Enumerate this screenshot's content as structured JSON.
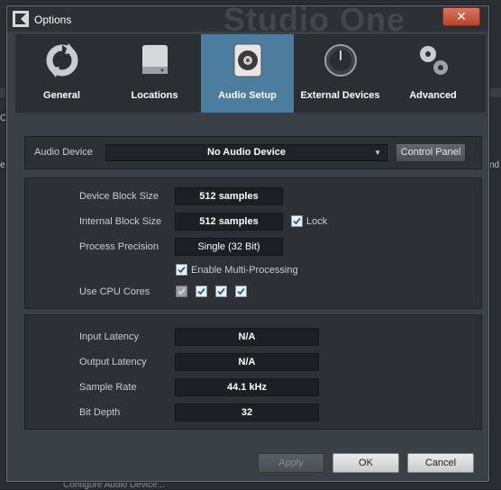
{
  "window": {
    "title": "Options",
    "watermark": "Studio One"
  },
  "tabs": [
    {
      "label": "General",
      "icon": "refresh-icon"
    },
    {
      "label": "Locations",
      "icon": "hard-drive-icon"
    },
    {
      "label": "Audio Setup",
      "icon": "speaker-icon",
      "active": true
    },
    {
      "label": "External Devices",
      "icon": "knob-icon"
    },
    {
      "label": "Advanced",
      "icon": "gears-icon"
    }
  ],
  "audio_device": {
    "label": "Audio Device",
    "value": "No Audio Device",
    "control_panel": "Control Panel"
  },
  "settings": {
    "device_block_size": {
      "label": "Device Block Size",
      "value": "512 samples"
    },
    "internal_block_size": {
      "label": "Internal Block Size",
      "value": "512 samples",
      "lock_label": "Lock",
      "lock_checked": true
    },
    "process_precision": {
      "label": "Process Precision",
      "value": "Single (32 Bit)"
    },
    "multi_processing": {
      "label": "Enable Multi-Processing",
      "checked": true
    },
    "cpu_cores": {
      "label": "Use CPU Cores",
      "cores": [
        {
          "checked": true,
          "enabled": false
        },
        {
          "checked": true,
          "enabled": true
        },
        {
          "checked": true,
          "enabled": true
        },
        {
          "checked": true,
          "enabled": true
        }
      ]
    }
  },
  "info": {
    "input_latency": {
      "label": "Input Latency",
      "value": "N/A"
    },
    "output_latency": {
      "label": "Output Latency",
      "value": "N/A"
    },
    "sample_rate": {
      "label": "Sample Rate",
      "value": "44.1 kHz"
    },
    "bit_depth": {
      "label": "Bit Depth",
      "value": "32"
    }
  },
  "buttons": {
    "apply": "Apply",
    "ok": "OK",
    "cancel": "Cancel"
  },
  "background": {
    "frag_left": "Cr",
    "frag_left2": "e",
    "frag_right": "nd",
    "bottom_text": "Configure Audio Device..."
  },
  "colors": {
    "accent": "#4d7d9e",
    "close": "#c45a40"
  }
}
